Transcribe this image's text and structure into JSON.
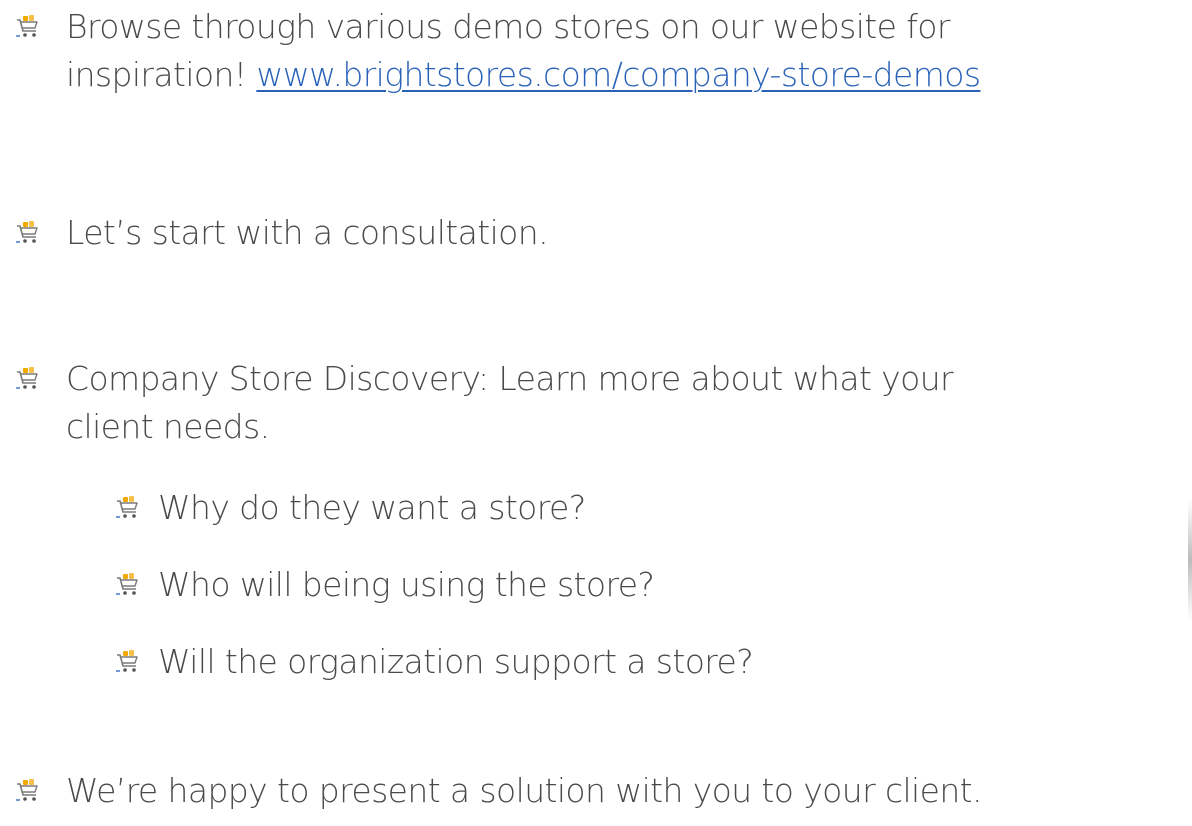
{
  "bullets": [
    {
      "line1": "Browse through various demo stores on our website for",
      "line2_prefix": "inspiration! ",
      "link_text": "www.brightstores.com/company-store-demos"
    },
    {
      "text": "Let’s start with a consultation."
    },
    {
      "line1": "Company Store Discovery: Learn more about what your",
      "line2": "client needs."
    },
    {
      "text": "We’re happy to present a solution with you to your client."
    }
  ],
  "sub_bullets": [
    {
      "text": "Why do they want a store?"
    },
    {
      "text": "Who will being using the store?"
    },
    {
      "text": "Will the organization support a store?"
    }
  ],
  "icon": "shopping-cart-icon",
  "colors": {
    "text": "#4a4a4a",
    "link": "#2a62b8",
    "cart_accent": "#f2a900",
    "cart_blue": "#3b6cc2"
  }
}
